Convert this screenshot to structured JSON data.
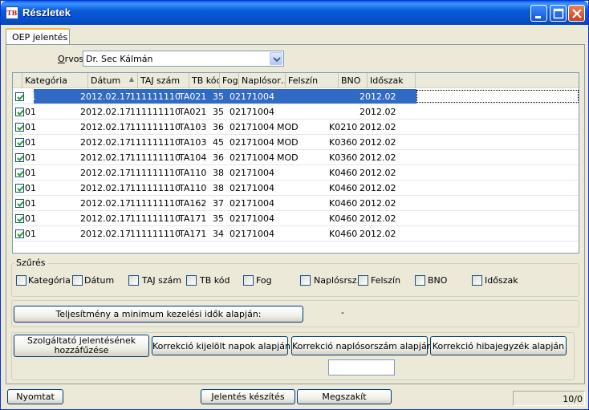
{
  "window": {
    "title": "Részletek",
    "app_icon_text": "TB"
  },
  "tabs": [
    {
      "label": "OEP jelentés"
    }
  ],
  "doctor": {
    "label": "Orvos",
    "value": "Dr. Sec Kálmán"
  },
  "grid": {
    "columns": [
      "Kategória",
      "Dátum",
      "TAJ szám",
      "TB kód",
      "Fog",
      "Naplósor…",
      "Felszín",
      "BNO",
      "Időszak"
    ],
    "rows": [
      {
        "checked": true,
        "selected": true,
        "kategoria": "01",
        "datum": "2012.02.17",
        "taj": "111111110",
        "tb": "TA021",
        "fog": "35",
        "naplo": "02171004",
        "felszin": "",
        "bno": "",
        "idoszak": "2012.02"
      },
      {
        "checked": true,
        "selected": false,
        "kategoria": "01",
        "datum": "2012.02.17",
        "taj": "111111110",
        "tb": "TA021",
        "fog": "35",
        "naplo": "02171004",
        "felszin": "",
        "bno": "",
        "idoszak": "2012.02"
      },
      {
        "checked": true,
        "selected": false,
        "kategoria": "01",
        "datum": "2012.02.17",
        "taj": "111111110",
        "tb": "TA103",
        "fog": "36",
        "naplo": "02171004",
        "felszin": "MOD",
        "bno": "K0210",
        "idoszak": "2012.02"
      },
      {
        "checked": true,
        "selected": false,
        "kategoria": "01",
        "datum": "2012.02.17",
        "taj": "111111110",
        "tb": "TA103",
        "fog": "45",
        "naplo": "02171004",
        "felszin": "MOD",
        "bno": "K0360",
        "idoszak": "2012.02"
      },
      {
        "checked": true,
        "selected": false,
        "kategoria": "01",
        "datum": "2012.02.17",
        "taj": "111111110",
        "tb": "TA104",
        "fog": "36",
        "naplo": "02171004",
        "felszin": "MOD",
        "bno": "K0360",
        "idoszak": "2012.02"
      },
      {
        "checked": true,
        "selected": false,
        "kategoria": "01",
        "datum": "2012.02.17",
        "taj": "111111110",
        "tb": "TA110",
        "fog": "38",
        "naplo": "02171004",
        "felszin": "",
        "bno": "K0460",
        "idoszak": "2012.02"
      },
      {
        "checked": true,
        "selected": false,
        "kategoria": "01",
        "datum": "2012.02.17",
        "taj": "111111110",
        "tb": "TA110",
        "fog": "38",
        "naplo": "02171004",
        "felszin": "",
        "bno": "K0460",
        "idoszak": "2012.02"
      },
      {
        "checked": true,
        "selected": false,
        "kategoria": "01",
        "datum": "2012.02.17",
        "taj": "111111110",
        "tb": "TA162",
        "fog": "37",
        "naplo": "02171004",
        "felszin": "",
        "bno": "K0460",
        "idoszak": "2012.02"
      },
      {
        "checked": true,
        "selected": false,
        "kategoria": "01",
        "datum": "2012.02.17",
        "taj": "111111110",
        "tb": "TA171",
        "fog": "35",
        "naplo": "02171004",
        "felszin": "",
        "bno": "K0460",
        "idoszak": "2012.02"
      },
      {
        "checked": true,
        "selected": false,
        "kategoria": "01",
        "datum": "2012.02.17",
        "taj": "111111110",
        "tb": "TA171",
        "fog": "34",
        "naplo": "02171004",
        "felszin": "",
        "bno": "K0460",
        "idoszak": "2012.02"
      }
    ]
  },
  "filter": {
    "title": "Szűrés",
    "options": [
      "Kategória",
      "Dátum",
      "TAJ szám",
      "TB kód",
      "Fog",
      "Naplósrsz.",
      "Felszín",
      "BNO",
      "Időszak"
    ]
  },
  "perf": {
    "button": "Teljesítmény a minimum kezelési idők alapján:",
    "value": "-"
  },
  "actions": {
    "b1_line1": "Szolgáltató jelentésének",
    "b1_line2": "hozzáfűzése",
    "b2": "Korrekció kijelölt napok alapján",
    "b3": "Korrekció naplósorszám alapján",
    "b4": "Korrekció hibajegyzék alapján"
  },
  "footer": {
    "print": "Nyomtat",
    "create": "Jelentés készítés",
    "cancel": "Megszakít",
    "status": "10/0"
  },
  "colors": {
    "title_bar": "#0a5bd9",
    "selection": "#316ac5",
    "tab_accent": "#f4b94a"
  }
}
